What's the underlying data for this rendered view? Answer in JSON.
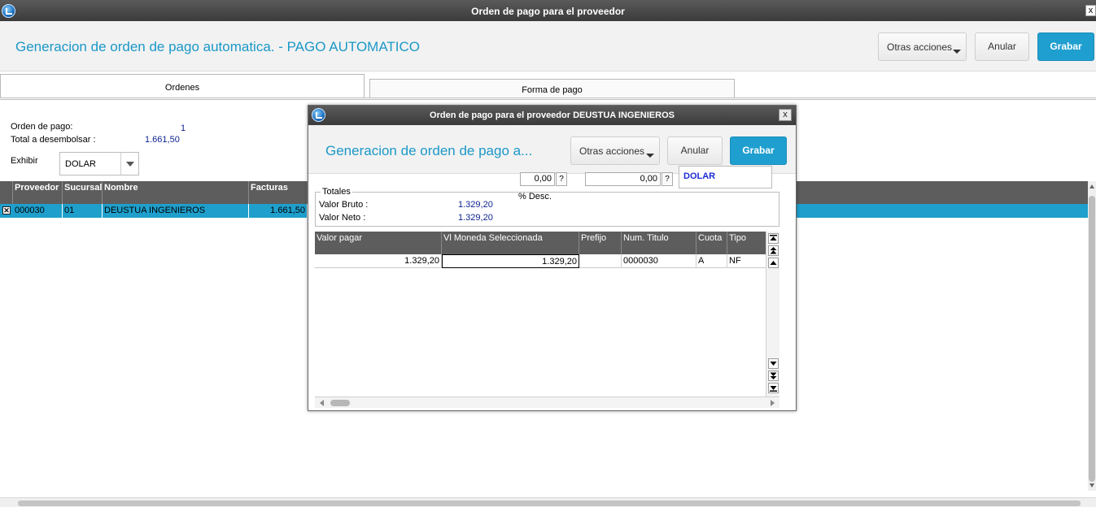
{
  "window": {
    "title": "Orden de pago para el proveedor",
    "close": "x"
  },
  "header": {
    "title": "Generacion de orden de pago automatica. - PAGO AUTOMATICO",
    "otras_acciones": "Otras acciones",
    "anular": "Anular",
    "grabar": "Grabar"
  },
  "tabs": [
    {
      "label": "Ordenes"
    },
    {
      "label": "Forma de pago"
    }
  ],
  "form": {
    "orden_label": "Orden de pago:",
    "orden_value": "1",
    "total_label": "Total a desembolsar :",
    "total_value": "1.661,50",
    "exhibir_label": "Exhibir",
    "exhibir_value": "DOLAR"
  },
  "grid": {
    "columns": [
      "Proveedor",
      "Sucursal",
      "Nombre",
      "Facturas"
    ],
    "rows": [
      {
        "checkbox": "✕",
        "proveedor": "000030",
        "sucursal": "01",
        "nombre": "DEUSTUA INGENIEROS",
        "facturas": "1.661,50"
      }
    ]
  },
  "modal": {
    "title": "Orden de pago para el proveedor DEUSTUA INGENIEROS",
    "close": "x",
    "header_title": "Generacion de orden de pago a...",
    "otras_acciones": "Otras acciones",
    "anular": "Anular",
    "grabar": "Grabar",
    "field1_value": "0,00",
    "field2_value": "0,00",
    "help": "?",
    "currency": "DOLAR",
    "desc_label": "% Desc.",
    "totales": {
      "legend": "Totales",
      "bruto_label": "Valor Bruto :",
      "bruto_value": "1.329,20",
      "neto_label": "Valor Neto  :",
      "neto_value": "1.329,20"
    },
    "grid": {
      "columns": [
        "Valor pagar",
        "Vl Moneda Seleccionada",
        "Prefijo",
        "Num. Titulo",
        "Cuota",
        "Tipo"
      ],
      "rows": [
        {
          "valor_pagar": "1.329,20",
          "vl_moneda": "1.329,20",
          "prefijo": "",
          "num_titulo": "0000030",
          "cuota": "A",
          "tipo": "NF"
        }
      ]
    }
  }
}
